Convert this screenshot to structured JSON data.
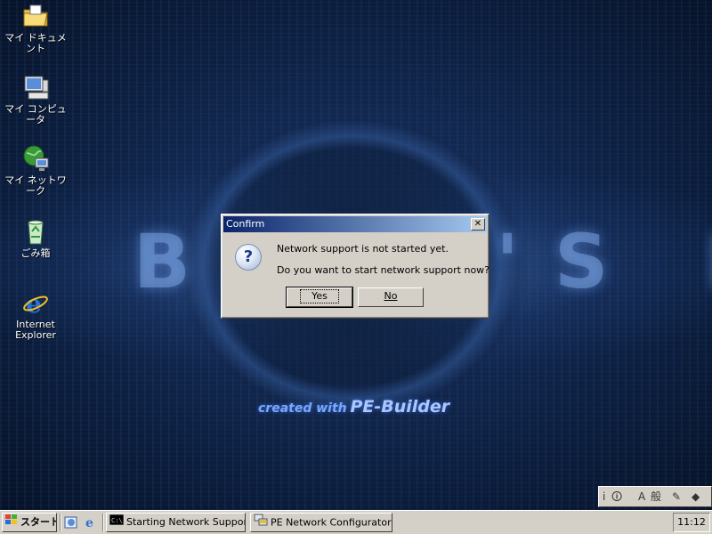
{
  "desktop": {
    "background_logo": "BART'S PE",
    "credit_prefix": "created with",
    "credit_name": "PE-Builder",
    "icons": [
      {
        "label": "マイ ドキュメント",
        "icon": "folder-icon"
      },
      {
        "label": "マイ コンピュータ",
        "icon": "computer-icon"
      },
      {
        "label": "マイ ネットワーク",
        "icon": "network-icon"
      },
      {
        "label": "ごみ箱",
        "icon": "recycle-bin-icon"
      },
      {
        "label": "Internet Explorer",
        "icon": "internet-explorer-icon"
      }
    ]
  },
  "dialog": {
    "title": "Confirm",
    "close_glyph": "✕",
    "message_line1": "Network support is not started yet.",
    "message_line2": "Do you want to start network support now?",
    "yes_label": "Yes",
    "no_label": "No",
    "icon": "question-icon"
  },
  "language_bar": {
    "mode": "A",
    "charset": "般"
  },
  "taskbar": {
    "start_label": "スタート",
    "tasks": [
      {
        "label": "Starting Network Support",
        "icon": "console-icon"
      },
      {
        "label": "PE Network Configurator",
        "icon": "network-config-icon"
      }
    ],
    "clock": "11:12"
  },
  "colors": {
    "titlebar_start": "#0a246a",
    "titlebar_end": "#a6caf0",
    "face": "#d4d0c8"
  }
}
